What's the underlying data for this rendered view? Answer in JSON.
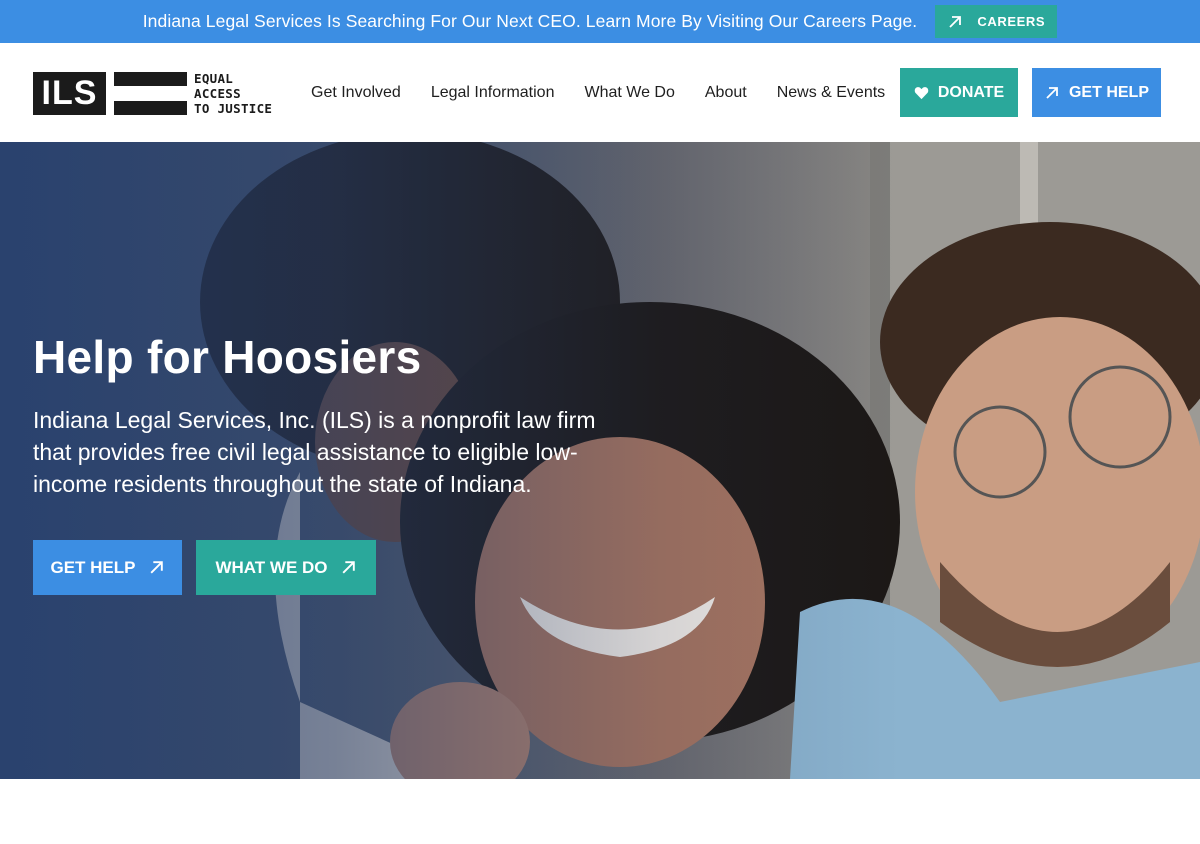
{
  "announcement": {
    "text": "Indiana Legal Services Is Searching For Our Next CEO. Learn More By Visiting Our Careers Page.",
    "button_label": "CAREERS"
  },
  "logo": {
    "mark": "ILS",
    "tagline": [
      "EQUAL",
      "ACCESS",
      "TO JUSTICE"
    ]
  },
  "nav": {
    "items": [
      "Get Involved",
      "Legal Information",
      "What We Do",
      "About",
      "News & Events"
    ]
  },
  "header_buttons": {
    "donate": "DONATE",
    "get_help": "GET HELP"
  },
  "hero": {
    "title": "Help for Hoosiers",
    "description": "Indiana Legal Services, Inc. (ILS) is a nonprofit law firm that provides free civil legal assistance to eligible low-income residents throughout the state of Indiana.",
    "buttons": [
      "GET HELP",
      "WHAT WE DO"
    ]
  },
  "colors": {
    "blue": "#3c8ee3",
    "teal": "#2aa89b",
    "dark": "#1b1b1b"
  },
  "icons": [
    "arrow-up-right-icon",
    "heart-icon"
  ]
}
